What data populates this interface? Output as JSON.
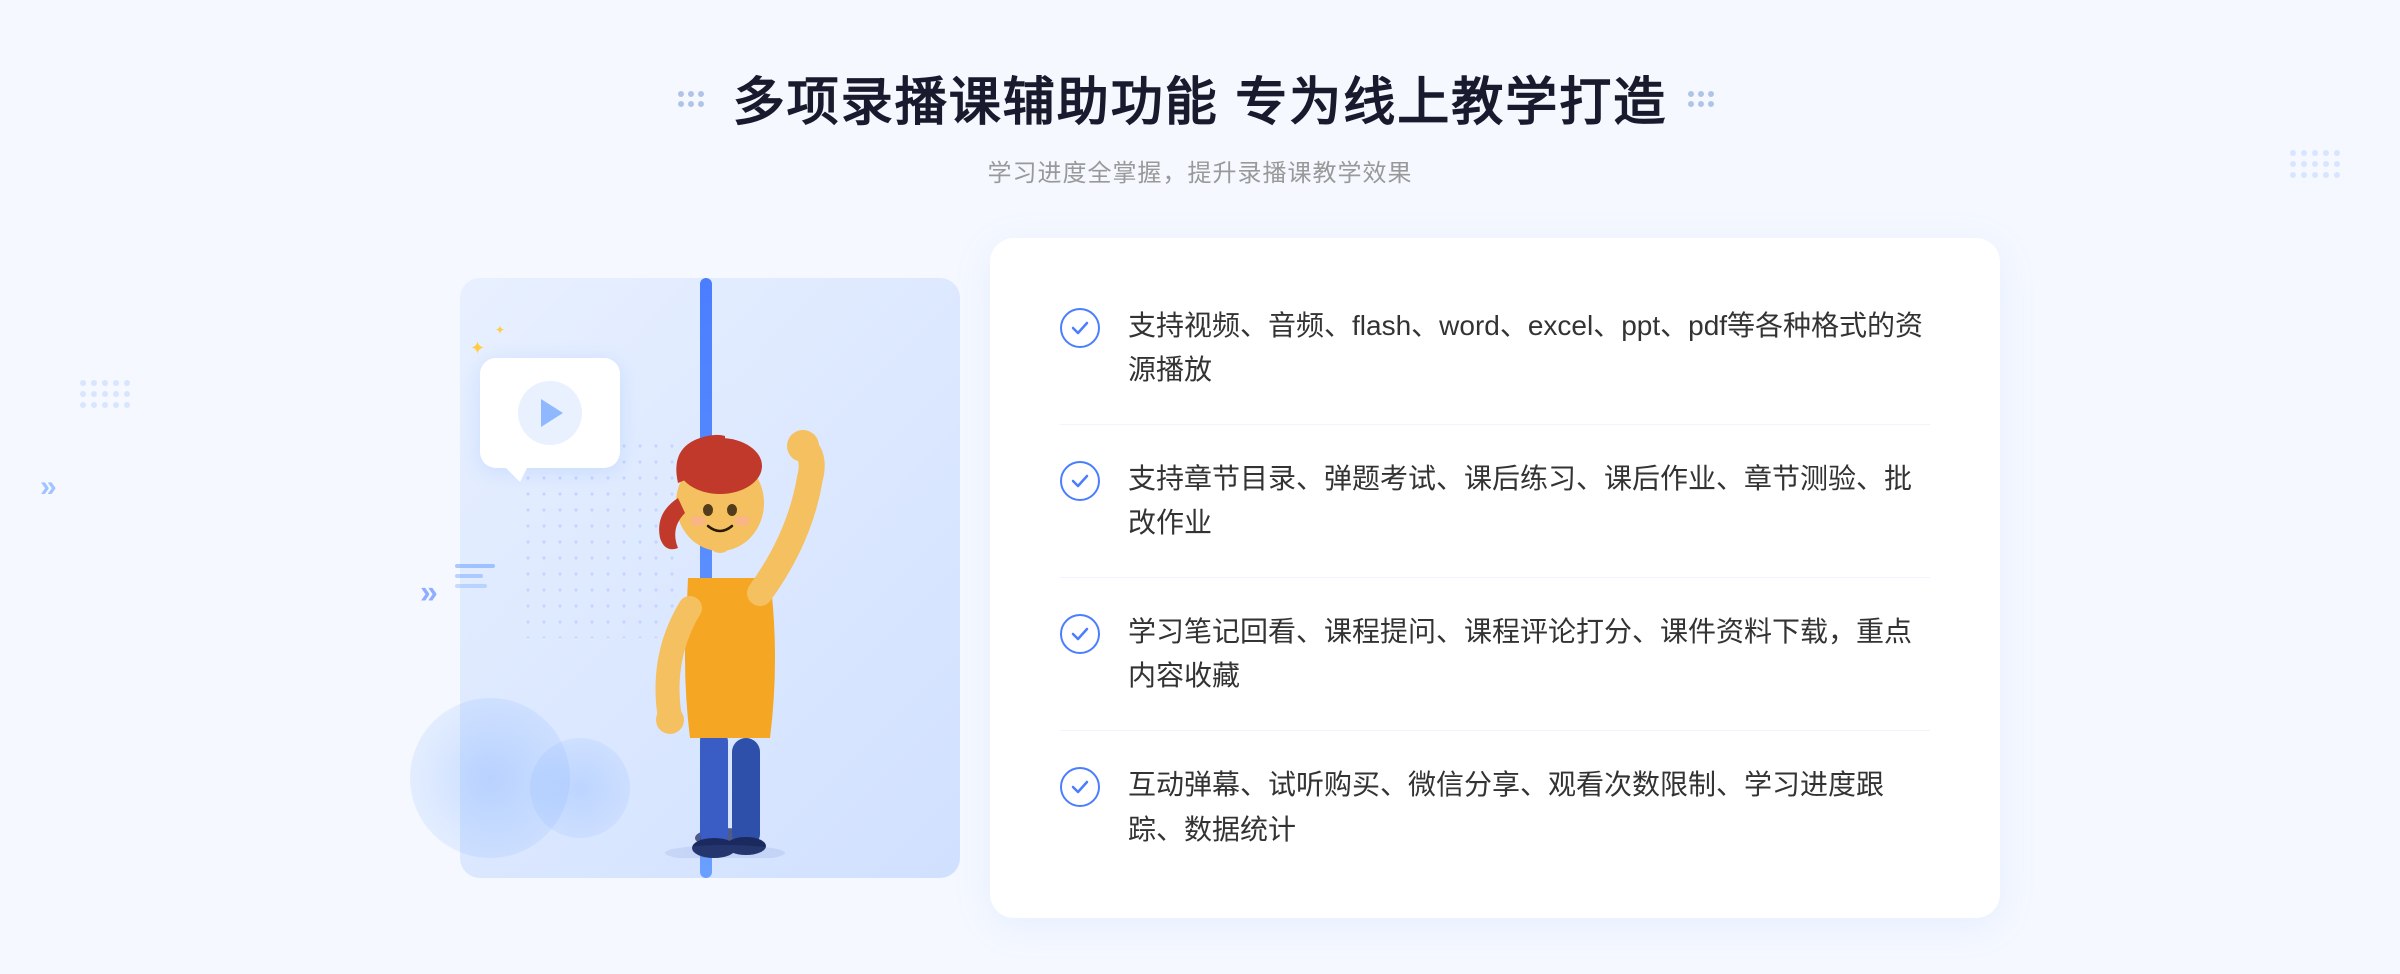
{
  "header": {
    "title": "多项录播课辅助功能 专为线上教学打造",
    "subtitle": "学习进度全掌握，提升录播课教学效果",
    "deco_left": "⠿",
    "deco_right": "⠿"
  },
  "features": [
    {
      "id": 1,
      "text": "支持视频、音频、flash、word、excel、ppt、pdf等各种格式的资源播放"
    },
    {
      "id": 2,
      "text": "支持章节目录、弹题考试、课后练习、课后作业、章节测验、批改作业"
    },
    {
      "id": 3,
      "text": "学习笔记回看、课程提问、课程评论打分、课件资料下载，重点内容收藏"
    },
    {
      "id": 4,
      "text": "互动弹幕、试听购买、微信分享、观看次数限制、学习进度跟踪、数据统计"
    }
  ],
  "colors": {
    "primary": "#4a7eff",
    "title": "#1a1a2e",
    "subtitle": "#999999",
    "text": "#333333",
    "bg": "#f5f8ff",
    "card_bg": "#e8f0ff",
    "white": "#ffffff"
  }
}
